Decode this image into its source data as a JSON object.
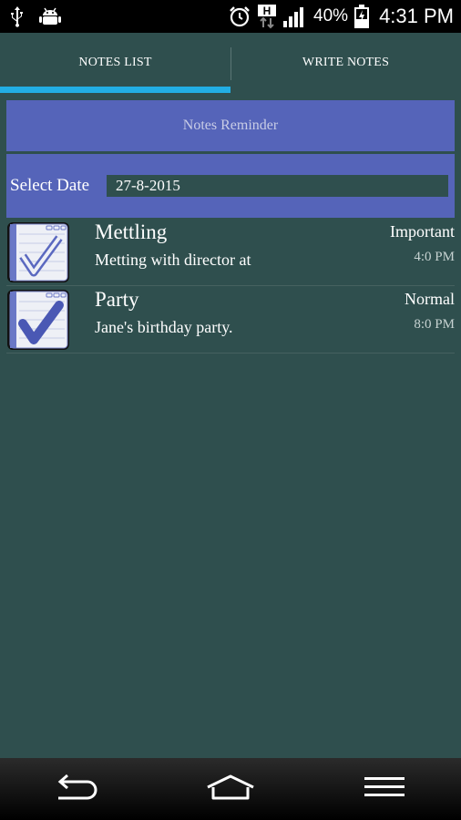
{
  "status_bar": {
    "battery_text": "40%",
    "time": "4:31 PM",
    "icons": [
      "usb-icon",
      "android-debug-icon",
      "alarm-icon",
      "hspa-icon",
      "signal-icon",
      "battery-charging-icon"
    ]
  },
  "tabs": [
    {
      "label": "NOTES LIST",
      "selected": true
    },
    {
      "label": "WRITE NOTES",
      "selected": false
    }
  ],
  "header": {
    "title": "Notes Reminder"
  },
  "date_picker": {
    "label": "Select Date",
    "value": "27-8-2015"
  },
  "notes": [
    {
      "title": "Mettling",
      "description": "Metting with director at",
      "priority": "Important",
      "time": "4:0 PM",
      "icon": "checklist-outline-icon"
    },
    {
      "title": "Party",
      "description": "Jane's birthday party.",
      "priority": "Normal",
      "time": "8:0 PM",
      "icon": "checklist-filled-icon"
    }
  ],
  "colors": {
    "background": "#2f4f4e",
    "panel": "#5564b9",
    "tab_indicator": "#22aee4"
  }
}
